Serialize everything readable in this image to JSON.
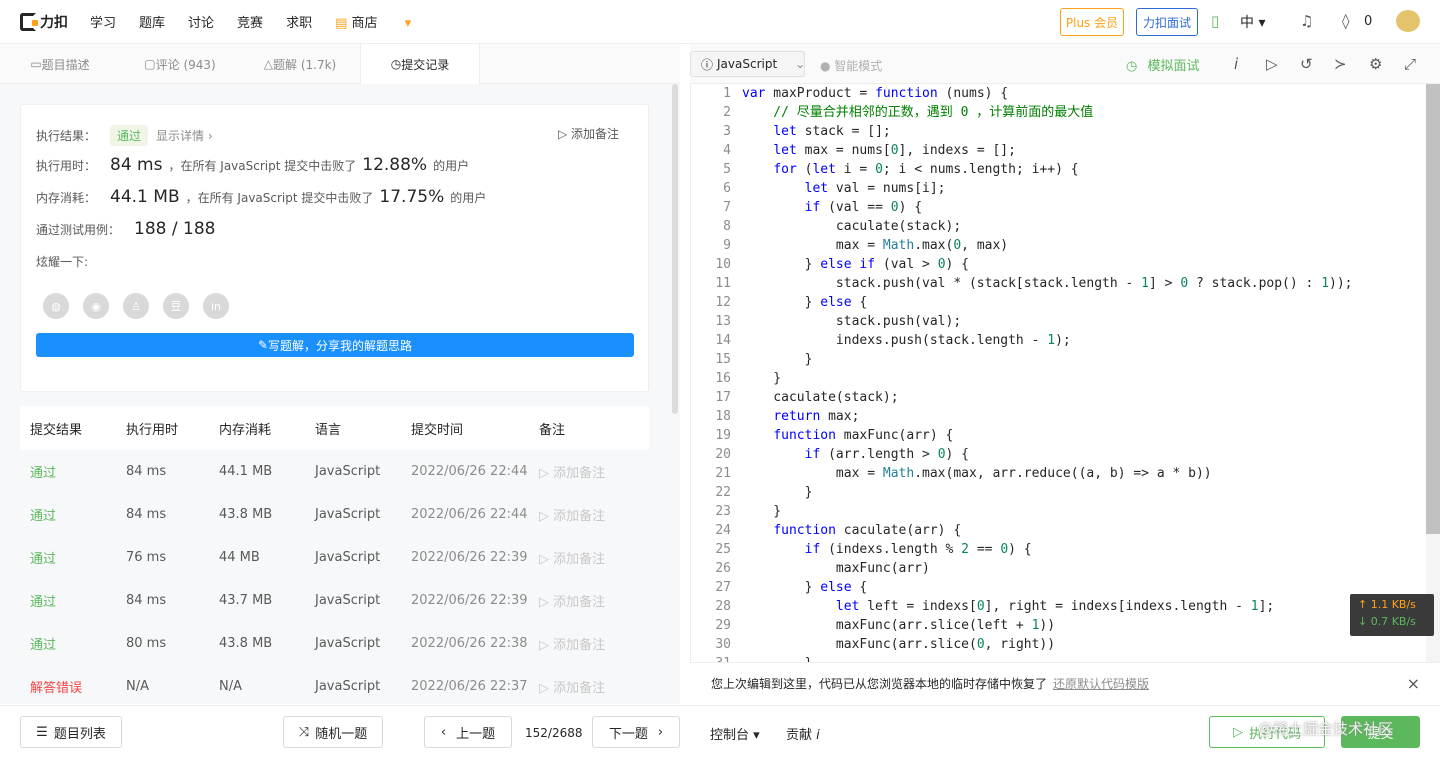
{
  "header": {
    "logo_text": "力扣",
    "nav": [
      "学习",
      "题库",
      "讨论",
      "竞赛",
      "求职"
    ],
    "shop": "商店",
    "plus": "Plus 会员",
    "mock": "力扣面试",
    "lang": "中",
    "coins": "0"
  },
  "left_tabs": [
    "题目描述",
    "评论 (943)",
    "题解 (1.7k)",
    "提交记录"
  ],
  "result": {
    "label_result": "执行结果：",
    "status": "通过",
    "details": "显示详情",
    "add_note": "添加备注",
    "label_time": "执行用时：",
    "time": "84 ms",
    "time_mid": "，在所有 JavaScript 提交中击败了",
    "time_pct": "12.88%",
    "time_end": "的用户",
    "label_mem": "内存消耗：",
    "mem": "44.1 MB",
    "mem_mid": "，在所有 JavaScript 提交中击败了",
    "mem_pct": "17.75%",
    "mem_end": "的用户",
    "label_cases": "通过测试用例：",
    "cases": "188 / 188",
    "label_share": "炫耀一下:",
    "write_btn": "写题解，分享我的解题思路"
  },
  "table": {
    "headers": [
      "提交结果",
      "执行用时",
      "内存消耗",
      "语言",
      "提交时间",
      "备注"
    ],
    "rows": [
      {
        "status": "通过",
        "time": "84 ms",
        "mem": "44.1 MB",
        "lang": "JavaScript",
        "date": "2022/06/26 22:44",
        "note": "添加备注"
      },
      {
        "status": "通过",
        "time": "84 ms",
        "mem": "43.8 MB",
        "lang": "JavaScript",
        "date": "2022/06/26 22:44",
        "note": "添加备注"
      },
      {
        "status": "通过",
        "time": "76 ms",
        "mem": "44 MB",
        "lang": "JavaScript",
        "date": "2022/06/26 22:39",
        "note": "添加备注"
      },
      {
        "status": "通过",
        "time": "84 ms",
        "mem": "43.7 MB",
        "lang": "JavaScript",
        "date": "2022/06/26 22:39",
        "note": "添加备注"
      },
      {
        "status": "通过",
        "time": "80 ms",
        "mem": "43.8 MB",
        "lang": "JavaScript",
        "date": "2022/06/26 22:38",
        "note": "添加备注"
      },
      {
        "status": "解答错误",
        "time": "N/A",
        "mem": "N/A",
        "lang": "JavaScript",
        "date": "2022/06/26 22:37",
        "note": "添加备注"
      }
    ]
  },
  "editor": {
    "language": "JavaScript",
    "smart_mode": "智能模式",
    "mock": "模拟面试",
    "lines": [
      "var maxProduct = function (nums) {",
      "    // 尽量合并相邻的正数，遇到 0 ，计算前面的最大值",
      "    let stack = [];",
      "    let max = nums[0], indexs = [];",
      "    for (let i = 0; i < nums.length; i++) {",
      "        let val = nums[i];",
      "        if (val == 0) {",
      "            caculate(stack);",
      "            max = Math.max(0, max)",
      "        } else if (val > 0) {",
      "            stack.push(val * (stack[stack.length - 1] > 0 ? stack.pop() : 1));",
      "        } else {",
      "            stack.push(val);",
      "            indexs.push(stack.length - 1);",
      "        }",
      "    }",
      "    caculate(stack);",
      "    return max;",
      "    function maxFunc(arr) {",
      "        if (arr.length > 0) {",
      "            max = Math.max(max, arr.reduce((a, b) => a * b))",
      "        }",
      "    }",
      "    function caculate(arr) {",
      "        if (indexs.length % 2 == 0) {",
      "            maxFunc(arr)",
      "        } else {",
      "            let left = indexs[0], right = indexs[indexs.length - 1];",
      "            maxFunc(arr.slice(left + 1))",
      "            maxFunc(arr.slice(0, right))",
      "        }"
    ],
    "notice": "您上次编辑到这里，代码已从您浏览器本地的临时存储中恢复了",
    "notice_link": "还原默认代码模版",
    "net_up": "↑ 1.1 KB/s",
    "net_down": "↓ 0.7 KB/s"
  },
  "bottom": {
    "list": "题目列表",
    "random": "随机一题",
    "prev": "上一题",
    "page": "152/2688",
    "next": "下一题",
    "console": "控制台",
    "contribute": "贡献",
    "run": "执行代码",
    "submit": "提交",
    "watermark": "@稀土掘金技术社区"
  }
}
